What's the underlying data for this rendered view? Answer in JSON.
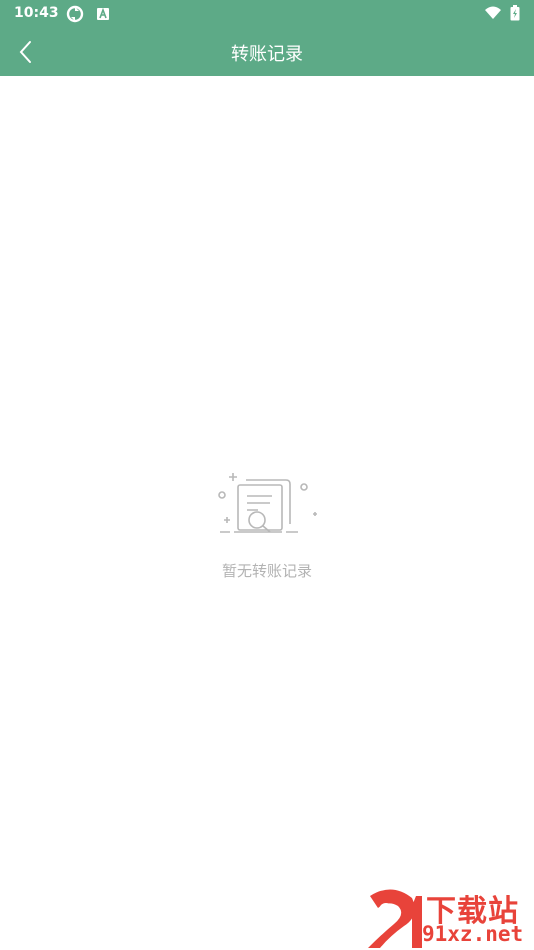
{
  "status_bar": {
    "time": "10:43",
    "left_icons": [
      "sync-icon",
      "a-badge-icon"
    ],
    "right_icons": [
      "wifi-icon",
      "battery-icon"
    ]
  },
  "header": {
    "title": "转账记录",
    "back_icon": "chevron-left-icon"
  },
  "empty_state": {
    "message": "暂无转账记录",
    "icon": "empty-document-search-icon"
  },
  "watermark": {
    "top_text": "下载站",
    "bottom_text": "91xz.net",
    "logo_text": "91"
  },
  "colors": {
    "header_bg": "#5daa87",
    "empty_text": "#b3b3b3",
    "watermark": "#e8433a"
  }
}
